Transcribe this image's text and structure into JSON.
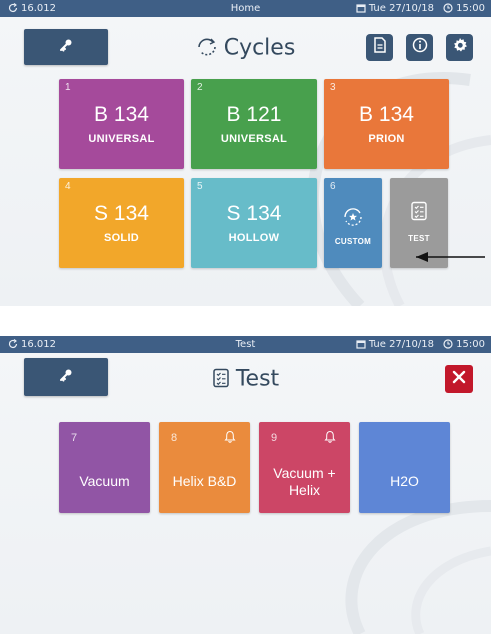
{
  "home": {
    "status": {
      "version": "16.012",
      "screen_name": "Home",
      "date": "Tue 27/10/18",
      "time": "15:00"
    },
    "title": "Cycles",
    "tiles": [
      {
        "num": "1",
        "name": "B 134",
        "sub": "UNIVERSAL",
        "color": "#a54a9b"
      },
      {
        "num": "2",
        "name": "B 121",
        "sub": "UNIVERSAL",
        "color": "#48a04d"
      },
      {
        "num": "3",
        "name": "B 134",
        "sub": "PRION",
        "color": "#e9773a"
      },
      {
        "num": "4",
        "name": "S 134",
        "sub": "SOLID",
        "color": "#f2a72a"
      },
      {
        "num": "5",
        "name": "S 134",
        "sub": "HOLLOW",
        "color": "#67bcc9"
      },
      {
        "num": "6",
        "name": "",
        "sub": "CUSTOM",
        "color": "#4f8bbd"
      },
      {
        "num": "",
        "name": "",
        "sub": "TEST",
        "color": "#9b9b9b"
      }
    ]
  },
  "test": {
    "status": {
      "version": "16.012",
      "screen_name": "Test",
      "date": "Tue 27/10/18",
      "time": "15:00"
    },
    "title": "Test",
    "tiles": [
      {
        "num": "7",
        "label": "Vacuum",
        "color": "#9155a5",
        "bell": false
      },
      {
        "num": "8",
        "label": "Helix B&D",
        "color": "#ea8b3d",
        "bell": true
      },
      {
        "num": "9",
        "label": "Vacuum + Helix",
        "color": "#cc4666",
        "bell": true
      },
      {
        "num": "",
        "label": "H2O",
        "color": "#5e86d6",
        "bell": false
      }
    ]
  },
  "colors": {
    "statusbar": "#3f5f86",
    "button": "#3a5675",
    "close": "#c2182b"
  }
}
